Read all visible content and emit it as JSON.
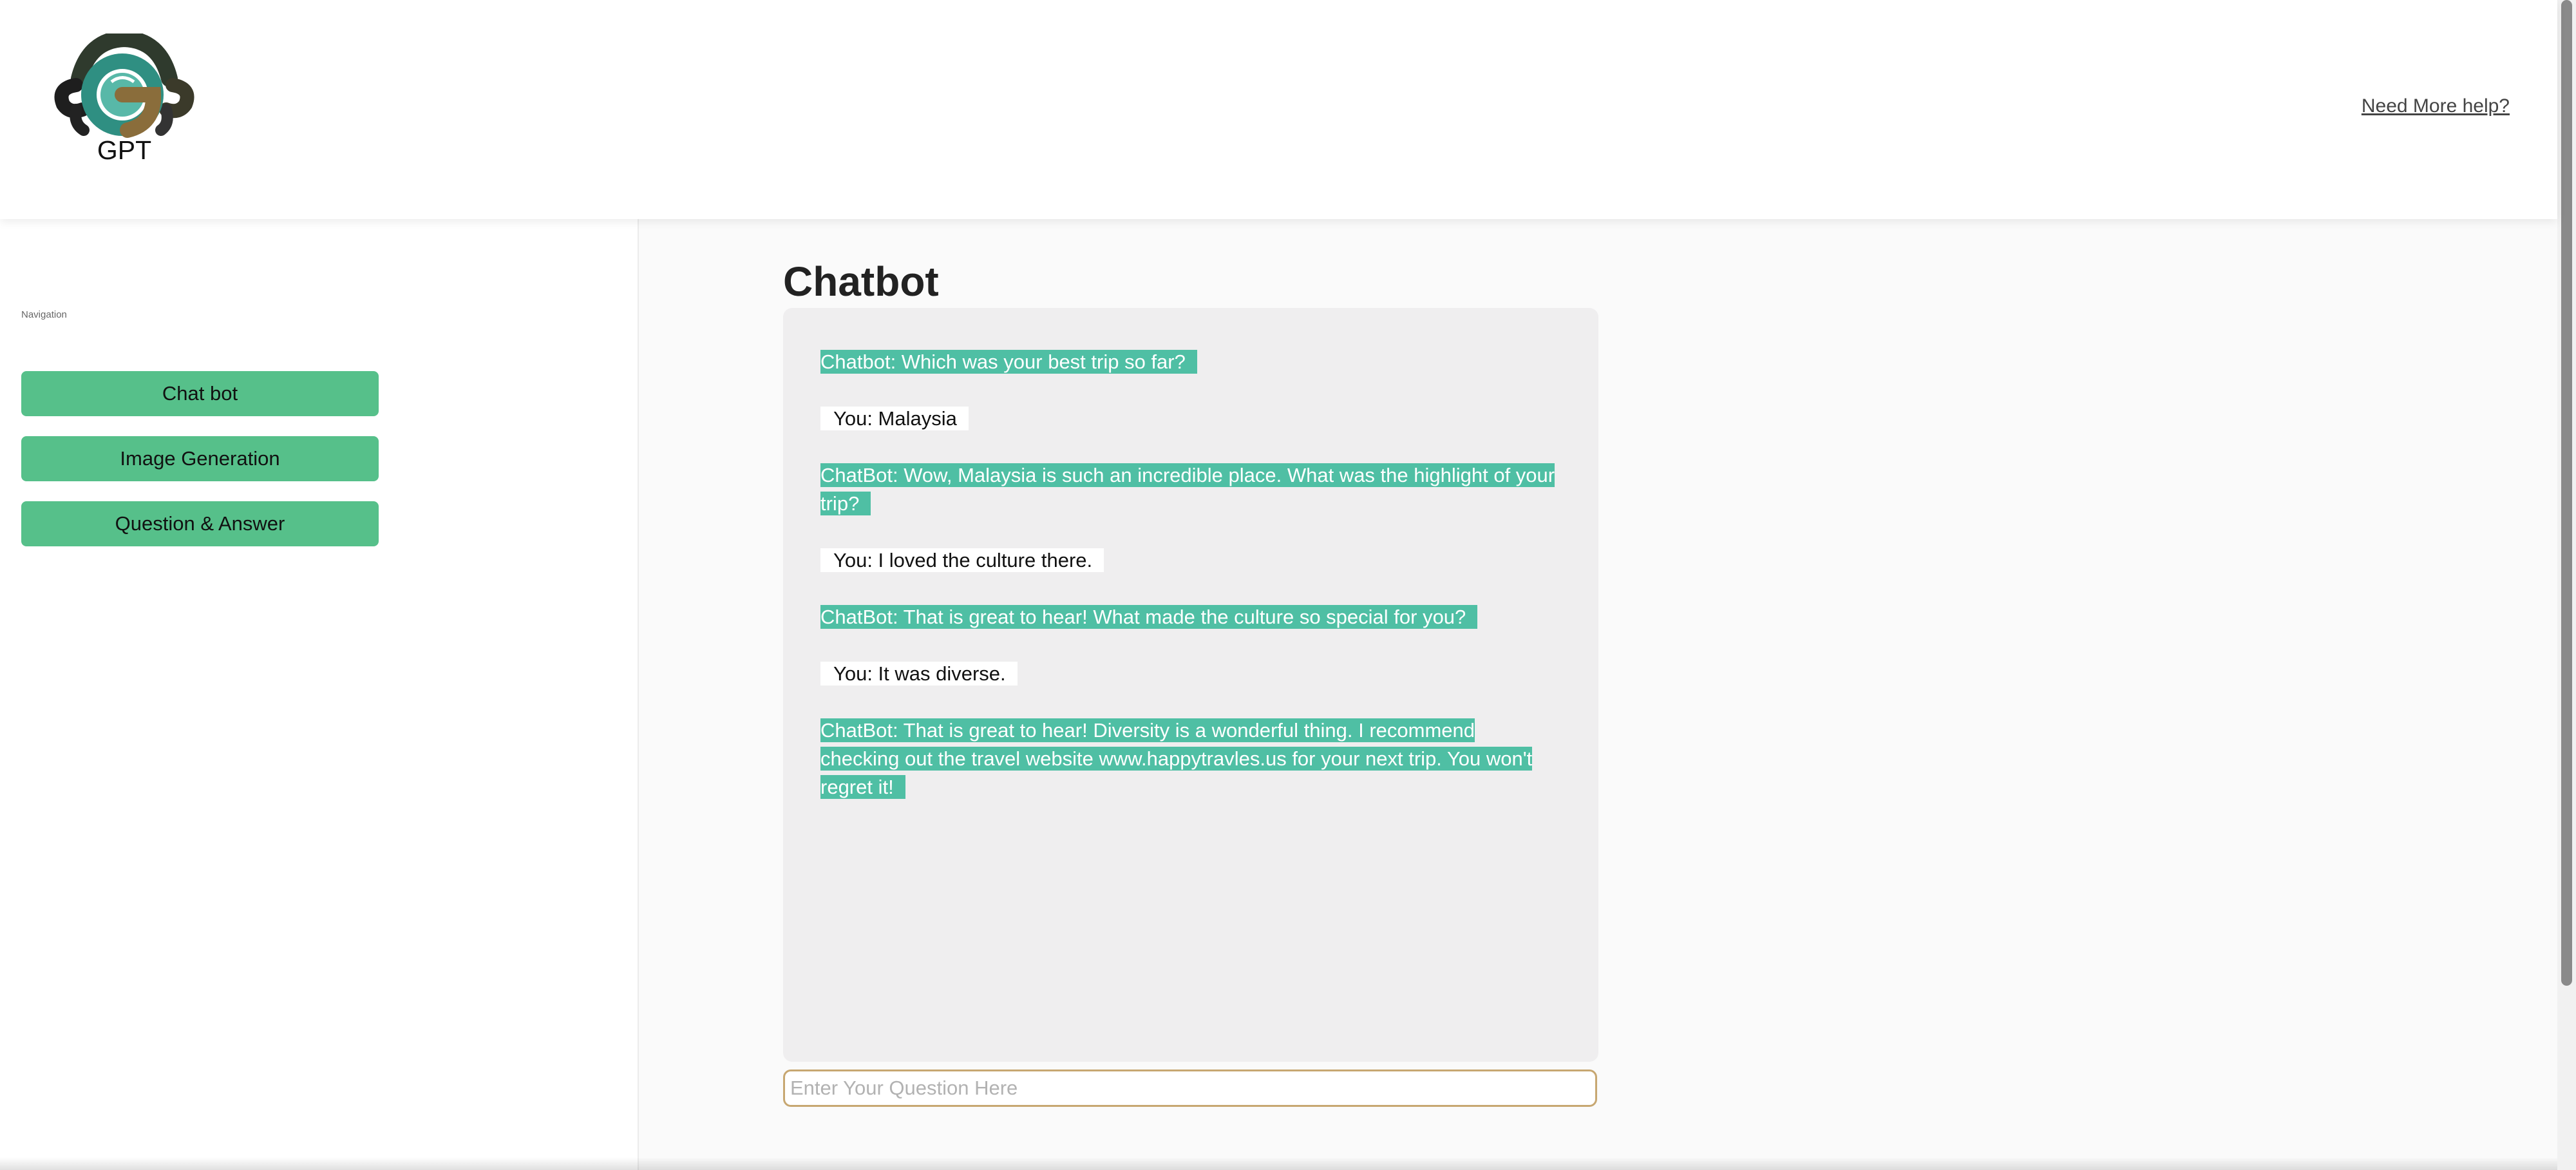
{
  "header": {
    "logo_text": "GPT",
    "help_link": "Need More help?"
  },
  "sidebar": {
    "caption": "Navigation",
    "items": [
      {
        "label": "Chat bot"
      },
      {
        "label": "Image Generation"
      },
      {
        "label": "Question & Answer"
      }
    ]
  },
  "main": {
    "title": "Chatbot",
    "messages": [
      {
        "role": "bot",
        "text": "Chatbot: Which was your best trip so far?"
      },
      {
        "role": "user",
        "text": "You: Malaysia"
      },
      {
        "role": "bot",
        "text": " ChatBot: Wow, Malaysia is such an incredible place. What was the highlight of your trip? "
      },
      {
        "role": "user",
        "text": "You: I loved the culture there."
      },
      {
        "role": "bot",
        "text": " ChatBot: That is great to hear! What made the culture so special for you? "
      },
      {
        "role": "user",
        "text": "You: It was diverse."
      },
      {
        "role": "bot",
        "text": " ChatBot: That is great to hear! Diversity is a wonderful thing. I recommend checking out the travel website www.happytravles.us for your next trip. You won't regret it! "
      }
    ],
    "input_placeholder": "Enter Your Question Here",
    "input_value": ""
  },
  "colors": {
    "accent_green": "#56c08a",
    "bot_bubble": "#4fbfa4",
    "input_border": "#c7a771"
  },
  "icons": {
    "logo": "gpt-logo-icon"
  }
}
